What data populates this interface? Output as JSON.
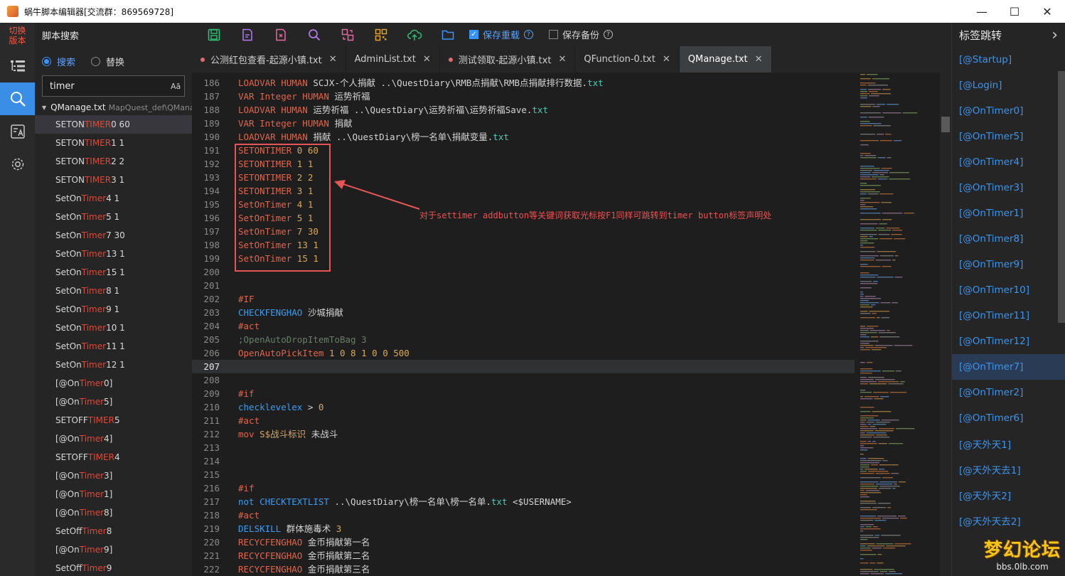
{
  "window": {
    "title": "蜗牛脚本编辑器[交流群：869569728]",
    "minimize": "—",
    "maximize": "☐",
    "close": "✕"
  },
  "activity": {
    "switch_version": "切换\n版本"
  },
  "search_panel": {
    "title": "脚本搜索",
    "mode_search": "搜索",
    "mode_replace": "替换",
    "query": "timer",
    "case_toggle": "Aā",
    "file_name": "QManage.txt",
    "file_path": "MapQuest_def\\QManage",
    "results": [
      {
        "pre": "SETON",
        "hit": "TIMER",
        "post": " 0 60"
      },
      {
        "pre": "SETON",
        "hit": "TIMER",
        "post": " 1 1"
      },
      {
        "pre": "SETON",
        "hit": "TIMER",
        "post": " 2 2"
      },
      {
        "pre": "SETON",
        "hit": "TIMER",
        "post": " 3 1"
      },
      {
        "pre": "SetOn",
        "hit": "Timer",
        "post": " 4 1"
      },
      {
        "pre": "SetOn",
        "hit": "Timer",
        "post": " 5 1"
      },
      {
        "pre": "SetOn",
        "hit": "Timer",
        "post": " 7 30"
      },
      {
        "pre": "SetOn",
        "hit": "Timer",
        "post": " 13 1"
      },
      {
        "pre": "SetOn",
        "hit": "Timer",
        "post": " 15 1"
      },
      {
        "pre": "SetOn",
        "hit": "Timer",
        "post": " 8 1"
      },
      {
        "pre": "SetOn",
        "hit": "Timer",
        "post": " 9 1"
      },
      {
        "pre": "SetOn",
        "hit": "Timer",
        "post": " 10 1"
      },
      {
        "pre": "SetOn",
        "hit": "Timer",
        "post": " 11 1"
      },
      {
        "pre": "SetOn",
        "hit": "Timer",
        "post": " 12 1"
      },
      {
        "pre": "[@On",
        "hit": "Timer",
        "post": "0]"
      },
      {
        "pre": "[@On",
        "hit": "Timer",
        "post": "5]"
      },
      {
        "pre": "SETOFF",
        "hit": "TIMER",
        "post": " 5"
      },
      {
        "pre": "[@On",
        "hit": "Timer",
        "post": "4]"
      },
      {
        "pre": "SETOFF",
        "hit": "TIMER",
        "post": " 4"
      },
      {
        "pre": "[@On",
        "hit": "Timer",
        "post": "3]"
      },
      {
        "pre": "[@On",
        "hit": "Timer",
        "post": "1]"
      },
      {
        "pre": "[@On",
        "hit": "Timer",
        "post": "8]"
      },
      {
        "pre": "SetOff",
        "hit": "Timer",
        "post": " 8"
      },
      {
        "pre": "[@On",
        "hit": "Timer",
        "post": "9]"
      },
      {
        "pre": "SetOff",
        "hit": "Timer",
        "post": " 9"
      }
    ]
  },
  "toolbar": {
    "save_reload": "保存重载",
    "save_backup": "保存备份",
    "help_glyph": "?"
  },
  "tabs": [
    {
      "label": "公测红包查看-起源小镇.txt",
      "modified": true
    },
    {
      "label": "AdminList.txt",
      "modified": false
    },
    {
      "label": "测试领取-起源小镇.txt",
      "modified": true
    },
    {
      "label": "QFunction-0.txt",
      "modified": false
    },
    {
      "label": "QManage.txt",
      "modified": false,
      "active": true
    }
  ],
  "tab_close": "✕",
  "editor": {
    "current_line": 207,
    "lines": [
      {
        "n": 186,
        "parts": [
          [
            "kw-orange",
            "LOADVAR HUMAN "
          ],
          [
            "plain",
            "SCJX-个人捐献 ..\\QuestDiary\\RMB点捐献\\RMB点捐献排行数据."
          ],
          [
            "ext",
            "txt"
          ]
        ]
      },
      {
        "n": 187,
        "parts": [
          [
            "kw-orange",
            "VAR Integer HUMAN "
          ],
          [
            "plain",
            "运势祈福"
          ]
        ]
      },
      {
        "n": 188,
        "parts": [
          [
            "kw-orange",
            "LOADVAR HUMAN "
          ],
          [
            "plain",
            "运势祈福 ..\\QuestDiary\\运势祈福\\运势祈福Save."
          ],
          [
            "ext",
            "txt"
          ]
        ]
      },
      {
        "n": 189,
        "parts": [
          [
            "kw-orange",
            "VAR Integer HUMAN "
          ],
          [
            "plain",
            "捐献"
          ]
        ]
      },
      {
        "n": 190,
        "parts": [
          [
            "kw-orange",
            "LOADVAR HUMAN "
          ],
          [
            "plain",
            "捐献 ..\\QuestDiary\\榜一名单\\捐献变量."
          ],
          [
            "ext",
            "txt"
          ]
        ]
      },
      {
        "n": 191,
        "parts": [
          [
            "kw-orange",
            "SETONTIMER "
          ],
          [
            "num",
            "0 60"
          ]
        ]
      },
      {
        "n": 192,
        "parts": [
          [
            "kw-orange",
            "SETONTIMER "
          ],
          [
            "num",
            "1 1"
          ]
        ]
      },
      {
        "n": 193,
        "parts": [
          [
            "kw-orange",
            "SETONTIMER "
          ],
          [
            "num",
            "2 2"
          ]
        ]
      },
      {
        "n": 194,
        "parts": [
          [
            "kw-orange",
            "SETONTIMER "
          ],
          [
            "num",
            "3 1"
          ]
        ]
      },
      {
        "n": 195,
        "parts": [
          [
            "kw-orange",
            "SetOnTimer "
          ],
          [
            "num",
            "4 1"
          ]
        ]
      },
      {
        "n": 196,
        "parts": [
          [
            "kw-orange",
            "SetOnTimer "
          ],
          [
            "num",
            "5 1"
          ]
        ]
      },
      {
        "n": 197,
        "parts": [
          [
            "kw-orange",
            "SetOnTimer "
          ],
          [
            "num",
            "7 30"
          ]
        ]
      },
      {
        "n": 198,
        "parts": [
          [
            "kw-orange",
            "SetOnTimer "
          ],
          [
            "num",
            "13 1"
          ]
        ]
      },
      {
        "n": 199,
        "parts": [
          [
            "kw-orange",
            "SetOnTimer "
          ],
          [
            "num",
            "15 1"
          ]
        ]
      },
      {
        "n": 200,
        "parts": []
      },
      {
        "n": 201,
        "parts": []
      },
      {
        "n": 202,
        "parts": [
          [
            "kw-orange",
            "#IF"
          ]
        ]
      },
      {
        "n": 203,
        "parts": [
          [
            "kw-blue",
            "CHECKFENGHAO "
          ],
          [
            "plain",
            "沙城捐献"
          ]
        ]
      },
      {
        "n": 204,
        "parts": [
          [
            "kw-orange",
            "#act"
          ]
        ]
      },
      {
        "n": 205,
        "parts": [
          [
            "cmt",
            ";OpenAutoDropItemToBag 3"
          ]
        ]
      },
      {
        "n": 206,
        "parts": [
          [
            "kw-orange",
            "OpenAutoPickItem "
          ],
          [
            "num",
            "1 0 8 1 0 0 500"
          ]
        ]
      },
      {
        "n": 207,
        "parts": []
      },
      {
        "n": 208,
        "parts": []
      },
      {
        "n": 209,
        "parts": [
          [
            "kw-orange",
            "#if"
          ]
        ]
      },
      {
        "n": 210,
        "parts": [
          [
            "kw-blue",
            "checklevelex "
          ],
          [
            "plain",
            "> "
          ],
          [
            "num",
            "0"
          ]
        ]
      },
      {
        "n": 211,
        "parts": [
          [
            "kw-orange",
            "#act"
          ]
        ]
      },
      {
        "n": 212,
        "parts": [
          [
            "kw-orange",
            "mov "
          ],
          [
            "kw-olive",
            "S$战斗标识 "
          ],
          [
            "plain",
            "未战斗"
          ]
        ]
      },
      {
        "n": 213,
        "parts": []
      },
      {
        "n": 214,
        "parts": []
      },
      {
        "n": 215,
        "parts": []
      },
      {
        "n": 216,
        "parts": [
          [
            "kw-orange",
            "#if"
          ]
        ]
      },
      {
        "n": 217,
        "parts": [
          [
            "kw-blue",
            "not CHECKTEXTLIST "
          ],
          [
            "plain",
            "..\\QuestDiary\\榜一名单\\榜一名单."
          ],
          [
            "ext",
            "txt"
          ],
          [
            "plain",
            " <$USERNAME>"
          ]
        ]
      },
      {
        "n": 218,
        "parts": [
          [
            "kw-orange",
            "#act"
          ]
        ]
      },
      {
        "n": 219,
        "parts": [
          [
            "kw-blue",
            "DELSKILL "
          ],
          [
            "plain",
            "群体施毒术 "
          ],
          [
            "num",
            "3"
          ]
        ]
      },
      {
        "n": 220,
        "parts": [
          [
            "kw-orange",
            "RECYCFENGHAO "
          ],
          [
            "plain",
            "金币捐献第一名"
          ]
        ]
      },
      {
        "n": 221,
        "parts": [
          [
            "kw-orange",
            "RECYCFENGHAO "
          ],
          [
            "plain",
            "金币捐献第二名"
          ]
        ]
      },
      {
        "n": 222,
        "parts": [
          [
            "kw-orange",
            "RECYCFENGHAO "
          ],
          [
            "plain",
            "金币捐献第三名"
          ]
        ]
      }
    ],
    "annotation": "对于settimer addbutton等关键词获取光标按F1同样可跳转到timer button标签声明处"
  },
  "right_panel": {
    "title": "标签跳转",
    "chevron": "›",
    "selected_index": 12,
    "labels": [
      "[@Startup]",
      "[@Login]",
      "[@OnTimer0]",
      "[@OnTimer5]",
      "[@OnTimer4]",
      "[@OnTimer3]",
      "[@OnTimer1]",
      "[@OnTimer8]",
      "[@OnTimer9]",
      "[@OnTimer10]",
      "[@OnTimer11]",
      "[@OnTimer12]",
      "[@OnTimer7]",
      "[@OnTimer2]",
      "[@OnTimer6]",
      "[@天外天1]",
      "[@天外天去1]",
      "[@天外天2]",
      "[@天外天去2]"
    ]
  },
  "watermark": {
    "main": "梦幻论坛",
    "sub": "bbs.0lb.com"
  },
  "colors": {
    "accent": "#3794ff",
    "highlight": "#e04836",
    "label": "#3a95f0"
  }
}
